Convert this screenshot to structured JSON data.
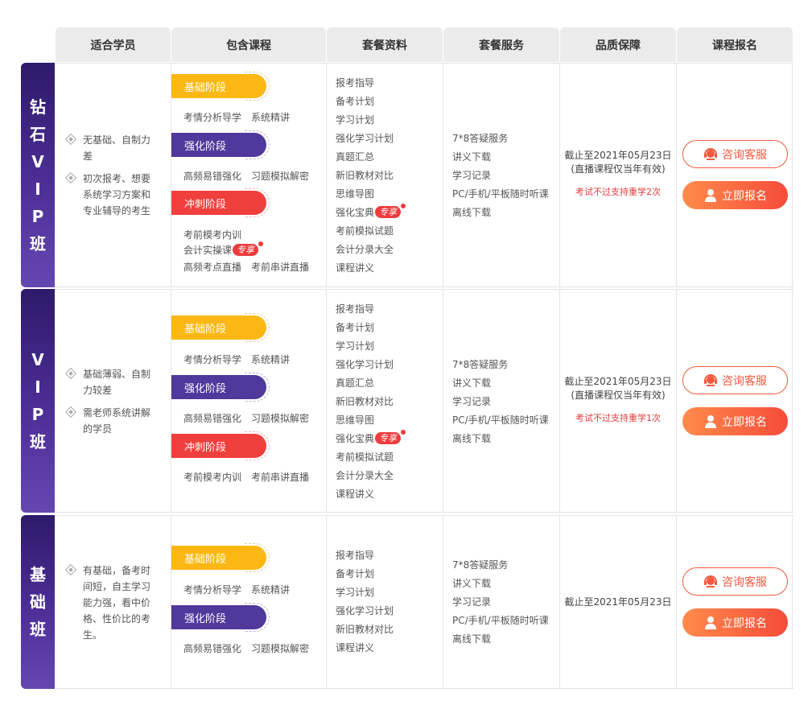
{
  "header": [
    "适合学员",
    "包含课程",
    "套餐资料",
    "套餐服务",
    "品质保障",
    "课程报名"
  ],
  "buttons": {
    "consult": "咨询客服",
    "enroll": "立即报名"
  },
  "badge": "专享",
  "plans": [
    {
      "label": [
        "钻",
        "石",
        "V",
        "I",
        "P",
        "班"
      ],
      "students": [
        "无基础、自制力差",
        "初次报考、想要系统学习方案和专业辅导的考生"
      ],
      "stages": [
        {
          "name": "基础阶段",
          "courses": [
            "考情分析导学",
            "系统精讲"
          ]
        },
        {
          "name": "强化阶段",
          "courses": [
            "高频易错强化",
            "习题模拟解密"
          ]
        },
        {
          "name": "冲刺阶段",
          "courses": [
            "考前模考内训"
          ],
          "extra": "会计实操课",
          "courses2": [
            "高频考点直播",
            "考前串讲直播"
          ]
        }
      ],
      "materials": [
        "报考指导",
        "备考计划",
        "学习计划",
        "强化学习计划",
        "真题汇总",
        "新旧教材对比",
        "思维导图",
        "强化宝典",
        "考前模拟试题",
        "会计分录大全",
        "课程讲义"
      ],
      "services": [
        "7*8答疑服务",
        "讲义下载",
        "学习记录",
        "PC/手机/平板随时听课",
        "离线下载"
      ],
      "guarantee": {
        "line1": "截止至2021年05月23日",
        "line2": "(直播课程仅当年有效)",
        "note": "考试不过支持重学2次"
      }
    },
    {
      "label": [
        "V",
        "I",
        "P",
        "班"
      ],
      "students": [
        "基础薄弱、自制力较差",
        "需老师系统讲解的学员"
      ],
      "stages": [
        {
          "name": "基础阶段",
          "courses": [
            "考情分析导学",
            "系统精讲"
          ]
        },
        {
          "name": "强化阶段",
          "courses": [
            "高频易错强化",
            "习题模拟解密"
          ]
        },
        {
          "name": "冲刺阶段",
          "courses": [
            "考前模考内训",
            "考前串讲直播"
          ]
        }
      ],
      "materials": [
        "报考指导",
        "备考计划",
        "学习计划",
        "强化学习计划",
        "真题汇总",
        "新旧教材对比",
        "思维导图",
        "强化宝典",
        "考前模拟试题",
        "会计分录大全",
        "课程讲义"
      ],
      "services": [
        "7*8答疑服务",
        "讲义下载",
        "学习记录",
        "PC/手机/平板随时听课",
        "离线下载"
      ],
      "guarantee": {
        "line1": "截止至2021年05月23日",
        "line2": "(直播课程仅当年有效)",
        "note": "考试不过支持重学1次"
      }
    },
    {
      "label": [
        "基",
        "础",
        "班"
      ],
      "students": [
        "有基础，备考时间短，自主学习能力强，看中价格、性价比的考生。"
      ],
      "stages": [
        {
          "name": "基础阶段",
          "courses": [
            "考情分析导学",
            "系统精讲"
          ]
        },
        {
          "name": "强化阶段",
          "courses": [
            "高频易错强化",
            "习题模拟解密"
          ]
        }
      ],
      "materials": [
        "报考指导",
        "备考计划",
        "学习计划",
        "强化学习计划",
        "新旧教材对比",
        "课程讲义"
      ],
      "services": [
        "7*8答疑服务",
        "讲义下载",
        "学习记录",
        "PC/手机/平板随时听课",
        "离线下载"
      ],
      "guarantee": {
        "line1": "截止至2021年05月23日"
      }
    }
  ]
}
